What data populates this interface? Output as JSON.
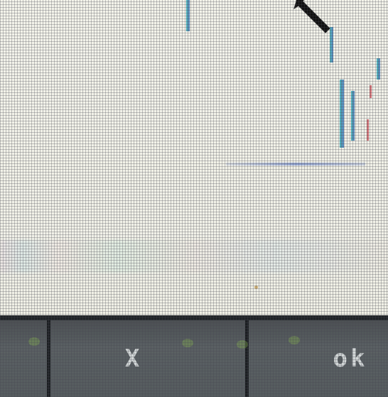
{
  "screen": {
    "description_hidden": ""
  },
  "taskbar": {
    "cell_1_label": "",
    "cell_2_label": "X",
    "cell_3_label": "ok"
  },
  "colors": {
    "background": "#f1f1e8",
    "taskbar": "#565c5f",
    "divider": "#1c1f22",
    "accent_line": "#1aa8b0"
  },
  "icons": {
    "cursor": "arrow-pointer-icon"
  }
}
